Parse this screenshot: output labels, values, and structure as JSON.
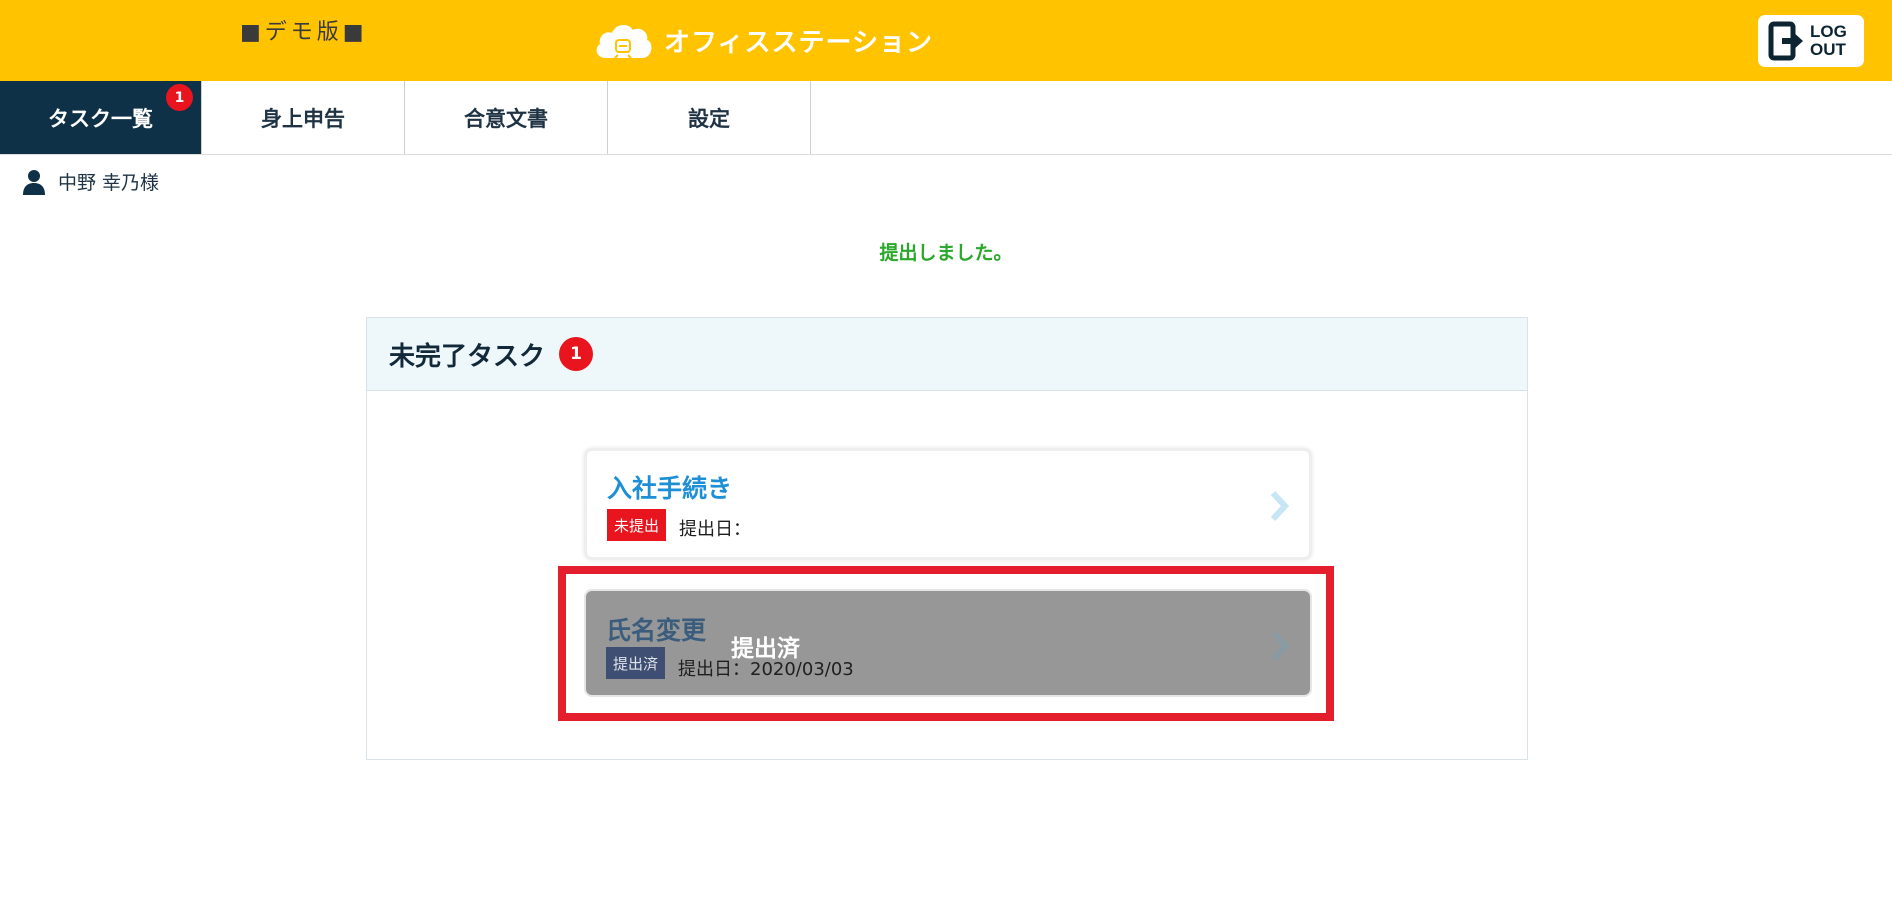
{
  "header": {
    "demo_label": "■デモ版■",
    "brand_name": "オフィスステーション",
    "logout_line1": "LOG",
    "logout_line2": "OUT"
  },
  "tabs": [
    {
      "label": "タスク一覧",
      "badge": "1",
      "active": true
    },
    {
      "label": "身上申告"
    },
    {
      "label": "合意文書"
    },
    {
      "label": "設定"
    }
  ],
  "user": {
    "name": "中野 幸乃様"
  },
  "flash_message": "提出しました。",
  "panel": {
    "title": "未完了タスク",
    "badge": "1",
    "tasks": [
      {
        "title": "入社手続き",
        "status": "未提出",
        "date_label": "提出日："
      },
      {
        "title": "氏名変更",
        "status": "提出済",
        "date_label": "提出日：2020/03/03",
        "overlay": "提出済"
      }
    ]
  },
  "colors": {
    "header_bg": "#ffc300",
    "active_tab": "#0e3148",
    "badge": "#e8141e",
    "flash": "#2aa82a",
    "link_blue": "#1c8fd6",
    "highlight": "#e51e2e"
  }
}
